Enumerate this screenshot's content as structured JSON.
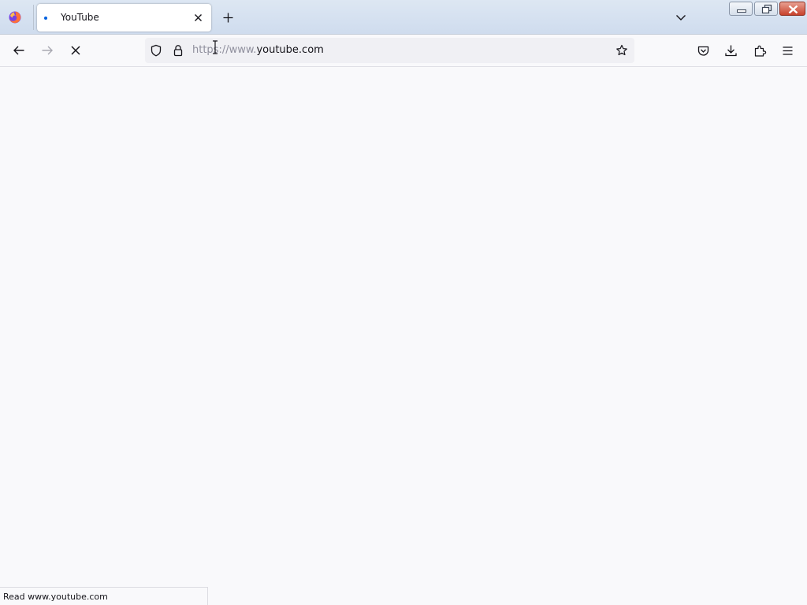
{
  "tab": {
    "title": "YouTube",
    "state": "loading"
  },
  "urlbar": {
    "scheme": "https://www.",
    "domain": "youtube.com"
  },
  "status": {
    "text": "Read www.youtube.com"
  },
  "icons": {
    "browser": "firefox-icon",
    "tab_close": "close-icon",
    "new_tab": "plus-icon",
    "list_tabs": "chevron-down-icon",
    "back": "arrow-left-icon",
    "forward": "arrow-right-icon",
    "stop": "stop-x-icon",
    "tracking": "shield-icon",
    "security": "lock-icon",
    "bookmark": "star-icon",
    "pocket": "pocket-icon",
    "downloads": "download-icon",
    "extensions": "puzzle-icon",
    "menu": "hamburger-icon"
  },
  "colors": {
    "accent": "#0060df",
    "chrome": "#f9f9fb",
    "titlebar": "#d6e1ef",
    "close_button": "#c8422c"
  }
}
